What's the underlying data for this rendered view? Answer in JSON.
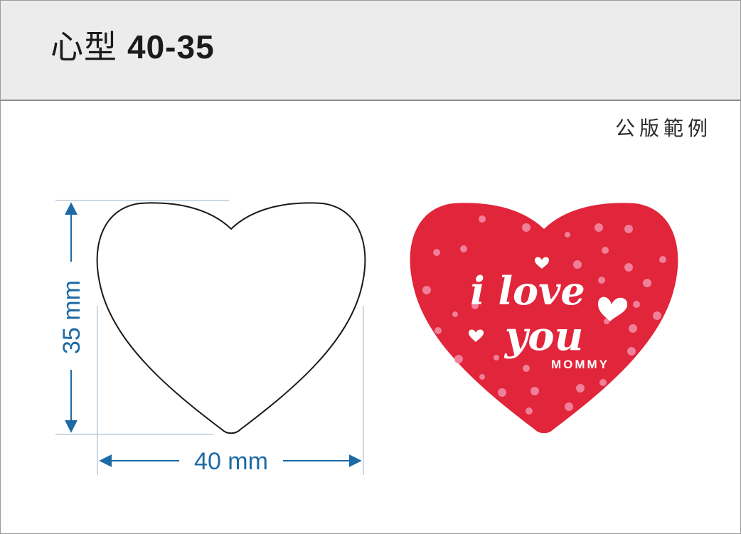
{
  "header": {
    "title_cn": "心型",
    "title_size": "40-35"
  },
  "public_label": "公版範例",
  "dimensions": {
    "height_label": "35 mm",
    "width_label": "40 mm"
  },
  "sample": {
    "line1": "i love",
    "line2": "you",
    "line3": "MOMMY"
  },
  "colors": {
    "accent_blue": "#1d6aa5",
    "heart_red": "#e1253a",
    "dot_pink": "#f07f9a"
  }
}
